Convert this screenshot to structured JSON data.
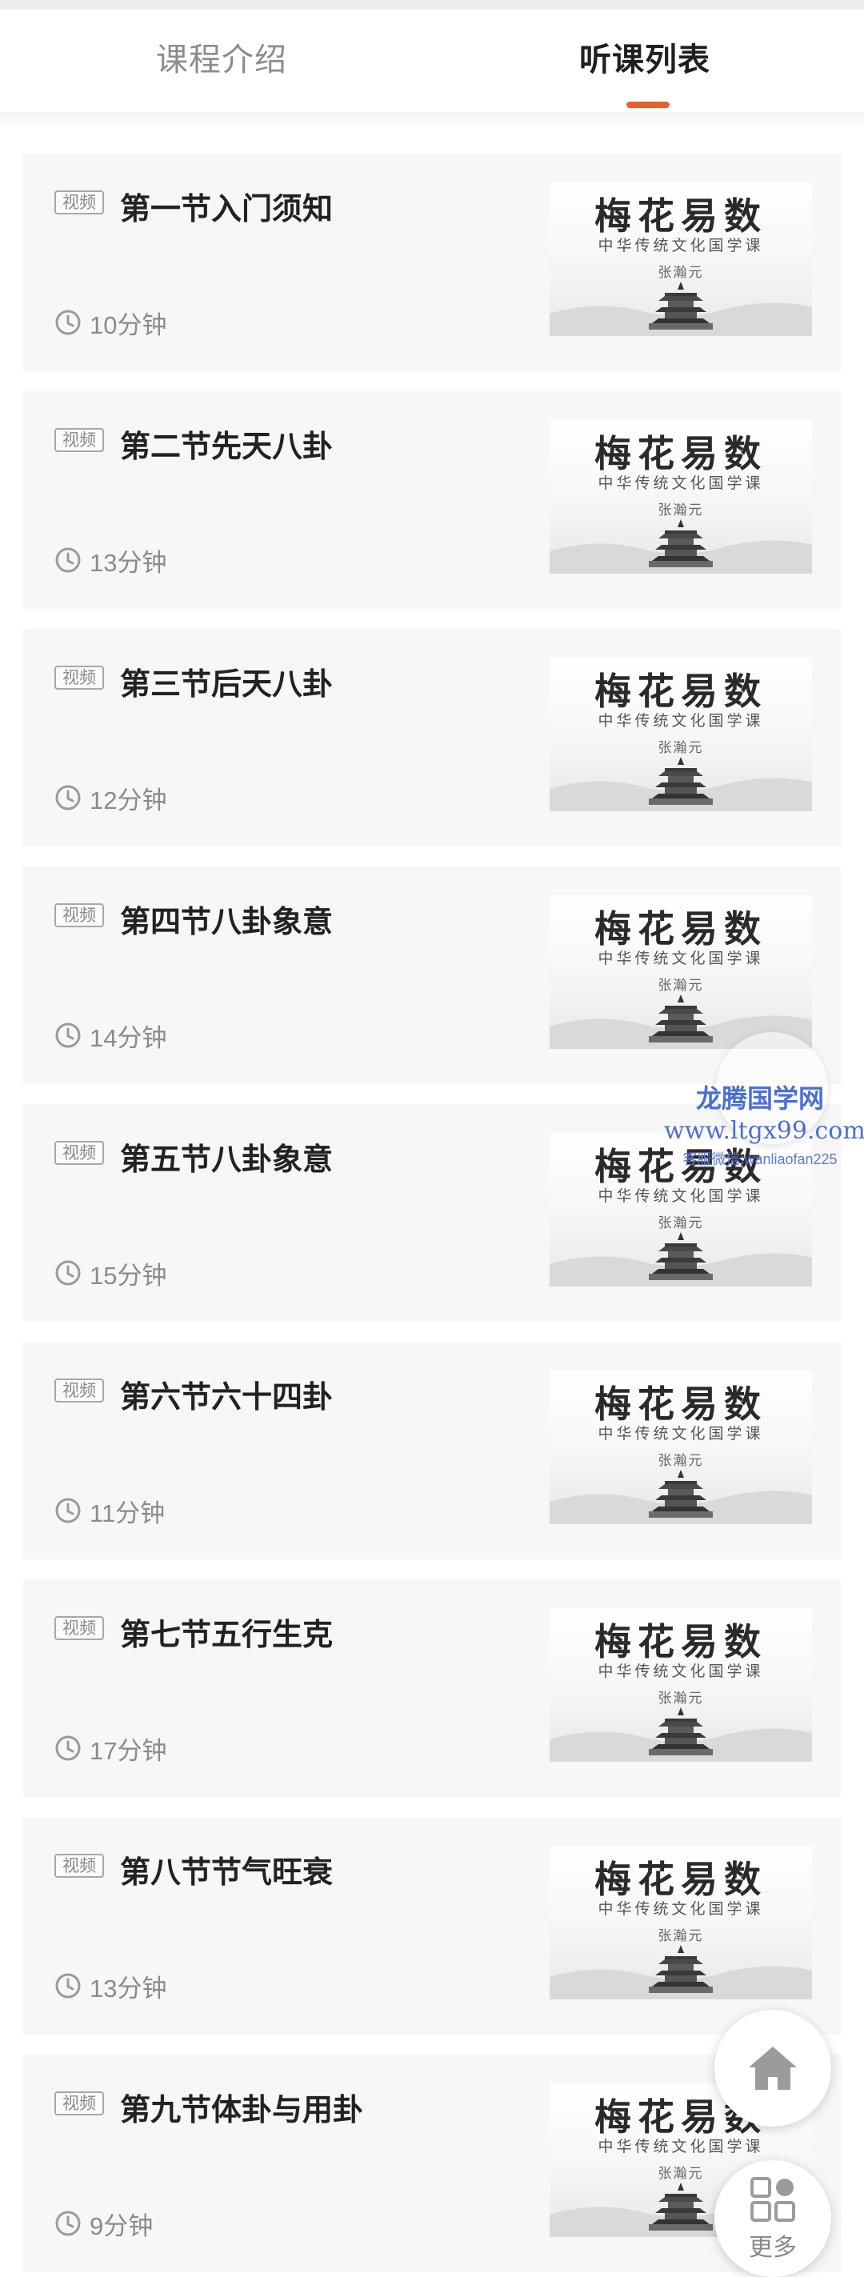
{
  "tabs": {
    "intro_label": "课程介绍",
    "list_label": "听课列表",
    "active_color": "#e4612e"
  },
  "lessons": [
    {
      "badge": "视频",
      "title": "第一节入门须知",
      "duration": "10分钟"
    },
    {
      "badge": "视频",
      "title": "第二节先天八卦",
      "duration": "13分钟"
    },
    {
      "badge": "视频",
      "title": "第三节后天八卦",
      "duration": "12分钟"
    },
    {
      "badge": "视频",
      "title": "第四节八卦象意",
      "duration": "14分钟"
    },
    {
      "badge": "视频",
      "title": "第五节八卦象意",
      "duration": "15分钟"
    },
    {
      "badge": "视频",
      "title": "第六节六十四卦",
      "duration": "11分钟"
    },
    {
      "badge": "视频",
      "title": "第七节五行生克",
      "duration": "17分钟"
    },
    {
      "badge": "视频",
      "title": "第八节节气旺衰",
      "duration": "13分钟"
    },
    {
      "badge": "视频",
      "title": "第九节体卦与用卦",
      "duration": "9分钟"
    }
  ],
  "thumbnail": {
    "title": "梅花易数",
    "subtitle": "中华传统文化国学课",
    "author": "张瀚元"
  },
  "watermark": {
    "line1": "龙腾国学网",
    "line2": "www.ltgx99.com",
    "line3": "客服微信:wanliaofan225"
  },
  "fab": {
    "home_icon": "home-icon",
    "more_label": "更多",
    "more_icon": "grid-icon"
  }
}
